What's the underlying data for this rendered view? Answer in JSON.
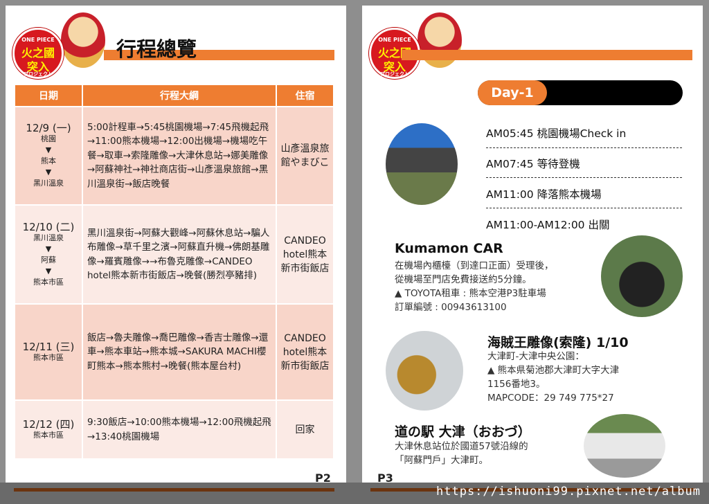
{
  "logo": {
    "text": "ONE PIECE 火之國 突入 プロジェクト"
  },
  "p2": {
    "title": "行程總覽",
    "headers": [
      "日期",
      "行程大綱",
      "住宿"
    ],
    "rows": [
      {
        "date": "12/9 (一)",
        "places": [
          "桃園",
          "▼",
          "熊本",
          "▼",
          "黑川溫泉"
        ],
        "schedule": "5:00計程車→5:45桃園機場→7:45飛機起飛→11:00熊本機場→12:00出機場→機場吃午餐→取車→索隆雕像→大津休息站→娜美雕像→阿蘇神社→神社商店街→山彥溫泉旅館→黑川溫泉街→飯店晚餐",
        "hotel": "山彥溫泉旅館やまびこ"
      },
      {
        "date": "12/10 (二)",
        "places": [
          "黑川溫泉",
          "▼",
          "阿蘇",
          "▼",
          "熊本市區"
        ],
        "schedule": "黑川溫泉街→阿蘇大觀峰→阿蘇休息站→騙人布雕像→草千里之濱→阿蘇直升機→佛朗基雕像→羅賓雕像→→布魯克雕像→CANDEO hotel熊本新市街飯店→晚餐(勝烈亭豬排)",
        "hotel": "CANDEO hotel熊本新市街飯店"
      },
      {
        "date": "12/11 (三)",
        "places": [
          "熊本市區"
        ],
        "schedule": "飯店→魯夫雕像→喬巴雕像→香吉士雕像→還車→熊本車站→熊本城→SAKURA MACHI櫻町熊本→熊本熊村→晚餐(熊本屋台村)",
        "hotel": "CANDEO hotel熊本新市街飯店"
      },
      {
        "date": "12/12 (四)",
        "places": [
          "熊本市區"
        ],
        "schedule": "9:30飯店→10:00熊本機場→12:00飛機起飛→13:40桃園機場",
        "hotel": "回家"
      }
    ],
    "page": "P2"
  },
  "p3": {
    "day": "Day-1",
    "times": [
      "AM05:45 桃園機場Check in",
      "AM07:45 等待登機",
      "AM11:00 降落熊本機場",
      "AM11:00-AM12:00 出關"
    ],
    "kumamon": {
      "title": "Kumamon CAR",
      "lines": [
        "在機場內櫃檯（到達口正面）受理後，",
        "從機場至門店免費接送約5分鐘。",
        "▲ TOYOTA租車 : 熊本空港P3駐車場",
        "訂單編號 : 00943613100"
      ]
    },
    "zoro": {
      "title": "海賊王雕像(索隆) 1/10",
      "lines": [
        "大津町-大津中央公園：",
        "▲ 熊本県菊池郡大津町大字大津",
        "1156番地3。",
        "MAPCODE：29 749 775*27"
      ]
    },
    "station": {
      "title": "道の駅 大津（おおづ）",
      "lines": [
        "大津休息站位於國道57號沿線的",
        "「阿蘇門戶」大津町。"
      ]
    },
    "page": "P3"
  },
  "watermark": "https://ishuoni99.pixnet.net/album",
  "colors": {
    "accent": "#ee7d31",
    "row_dark": "#f8d5c9",
    "row_light": "#fbeae5"
  }
}
